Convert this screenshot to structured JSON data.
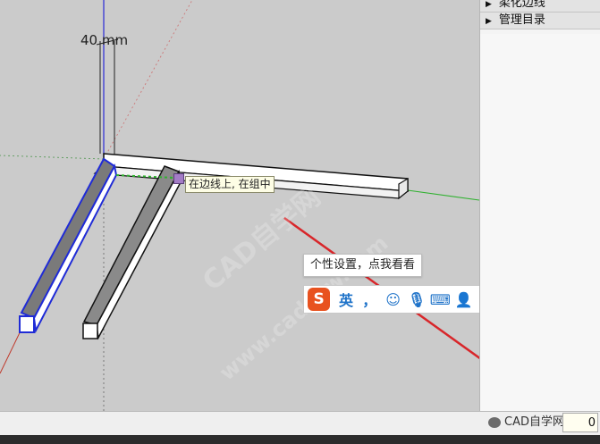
{
  "viewport": {
    "dimension_label": "40 mm",
    "snap_tooltip": "在边线上, 在组中",
    "watermark_main": "CAD自学网",
    "watermark_url": "www.cadzxw.com"
  },
  "ime": {
    "tip": "个性设置，点我看看",
    "logo": "S",
    "items": [
      {
        "label": "英",
        "icon": "language-toggle-icon"
      },
      {
        "label": "，",
        "icon": "punctuation-icon"
      },
      {
        "label": "☺",
        "icon": "emoji-icon"
      },
      {
        "label": "🎙",
        "icon": "microphone-icon"
      },
      {
        "label": "⌨",
        "icon": "keyboard-icon"
      },
      {
        "label": "👤",
        "icon": "user-icon"
      },
      {
        "label": "👕",
        "icon": "skin-icon"
      },
      {
        "label": "▦",
        "icon": "toolbox-icon"
      }
    ]
  },
  "tray": {
    "items": [
      {
        "label": "柔化边线"
      },
      {
        "label": "管理目录"
      }
    ]
  },
  "status": {
    "measurement_value": "0",
    "watermark_text": "CAD自学网"
  },
  "colors": {
    "selection_blue": "#1f2bd6",
    "axis_green": "#2fb12f",
    "axis_red": "#c0392b",
    "arrow_red": "#d8262a"
  }
}
